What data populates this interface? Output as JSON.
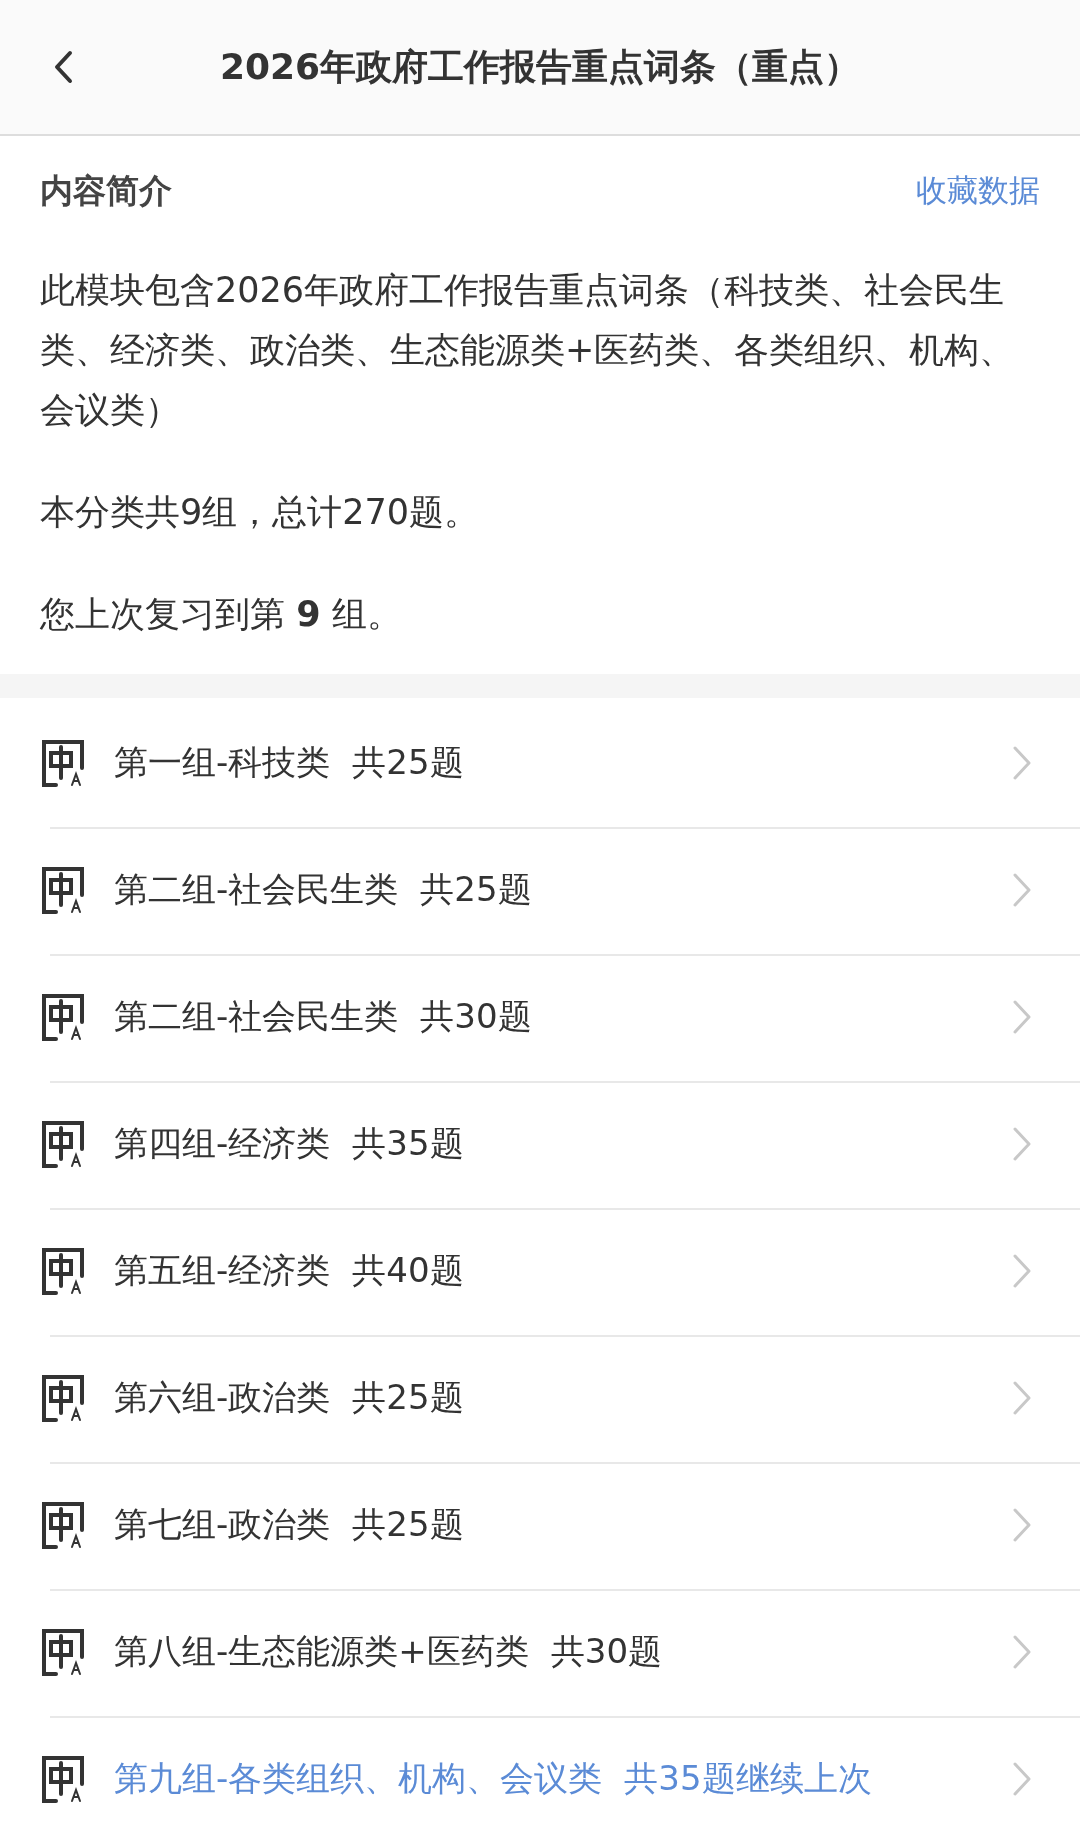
{
  "header": {
    "title": "2026年政府工作报告重点词条（重点）"
  },
  "intro": {
    "heading": "内容简介",
    "action": "收藏数据",
    "description": "此模块包含2026年政府工作报告重点词条（科技类、社会民生类、经济类、政治类、生态能源类+医药类、各类组织、机构、会议类）",
    "summary": "本分类共9组，总计270题。",
    "last_review": "您上次复习到第 **9** 组。"
  },
  "groups": [
    {
      "name": "第一组-科技类",
      "count": "共25题",
      "current": false
    },
    {
      "name": "第二组-社会民生类",
      "count": "共25题",
      "current": false
    },
    {
      "name": "第二组-社会民生类",
      "count": "共30题",
      "current": false
    },
    {
      "name": "第四组-经济类",
      "count": "共35题",
      "current": false
    },
    {
      "name": "第五组-经济类",
      "count": "共40题",
      "current": false
    },
    {
      "name": "第六组-政治类",
      "count": "共25题",
      "current": false
    },
    {
      "name": "第七组-政治类",
      "count": "共25题",
      "current": false
    },
    {
      "name": "第八组-生态能源类+医药类",
      "count": "共30题",
      "current": false
    },
    {
      "name": "第九组-各类组织、机构、会议类",
      "count": "共35题",
      "resume": "继续上次",
      "current": true
    }
  ]
}
